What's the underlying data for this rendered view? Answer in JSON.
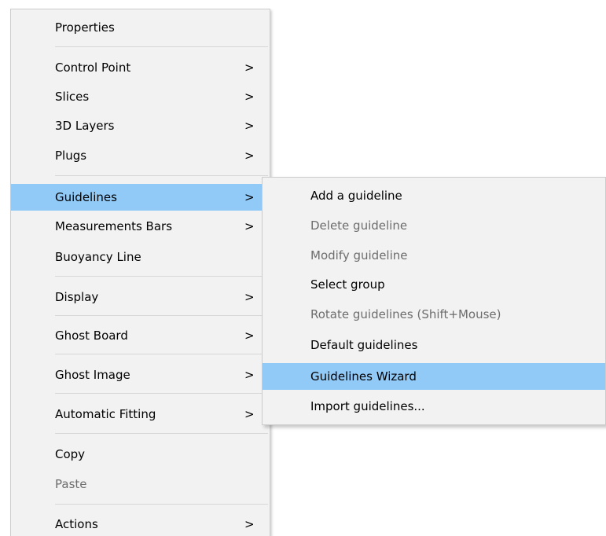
{
  "main_menu": {
    "items": [
      {
        "label": "Properties"
      },
      {
        "label": "Control Point",
        "submenu": true
      },
      {
        "label": "Slices",
        "submenu": true
      },
      {
        "label": "3D Layers",
        "submenu": true
      },
      {
        "label": "Plugs",
        "submenu": true
      },
      {
        "label": "Guidelines",
        "submenu": true,
        "highlighted": true
      },
      {
        "label": "Measurements Bars",
        "submenu": true
      },
      {
        "label": "Buoyancy Line"
      },
      {
        "label": "Display",
        "submenu": true
      },
      {
        "label": "Ghost Board",
        "submenu": true
      },
      {
        "label": "Ghost Image",
        "submenu": true
      },
      {
        "label": "Automatic Fitting",
        "submenu": true
      },
      {
        "label": "Copy"
      },
      {
        "label": "Paste",
        "disabled": true
      },
      {
        "label": "Actions",
        "submenu": true
      }
    ],
    "submenu_arrow": ">"
  },
  "guidelines_submenu": {
    "items": [
      {
        "label": "Add a guideline"
      },
      {
        "label": "Delete guideline",
        "disabled": true
      },
      {
        "label": "Modify guideline",
        "disabled": true
      },
      {
        "label": "Select group"
      },
      {
        "label": "Rotate guidelines (Shift+Mouse)",
        "disabled": true
      },
      {
        "label": "Default guidelines"
      },
      {
        "label": "Guidelines Wizard",
        "highlighted": true
      },
      {
        "label": "Import guidelines..."
      }
    ]
  },
  "colors": {
    "highlight": "#91c9f7",
    "menu_background": "#f2f2f2",
    "disabled_text": "#6d6d6d"
  }
}
